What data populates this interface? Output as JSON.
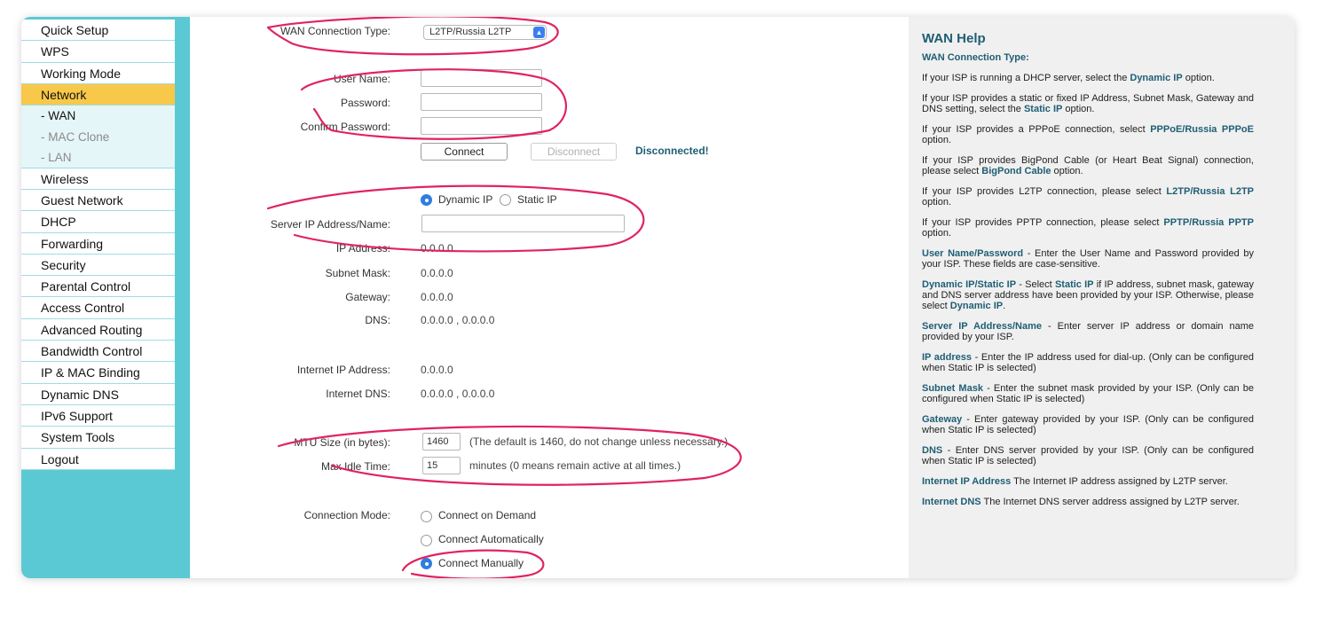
{
  "sidebar": {
    "items": [
      {
        "label": "Quick Setup"
      },
      {
        "label": "WPS"
      },
      {
        "label": "Working Mode"
      },
      {
        "label": "Network"
      },
      {
        "label": "- WAN"
      },
      {
        "label": "- MAC Clone"
      },
      {
        "label": "- LAN"
      },
      {
        "label": "Wireless"
      },
      {
        "label": "Guest Network"
      },
      {
        "label": "DHCP"
      },
      {
        "label": "Forwarding"
      },
      {
        "label": "Security"
      },
      {
        "label": "Parental Control"
      },
      {
        "label": "Access Control"
      },
      {
        "label": "Advanced Routing"
      },
      {
        "label": "Bandwidth Control"
      },
      {
        "label": "IP & MAC Binding"
      },
      {
        "label": "Dynamic DNS"
      },
      {
        "label": "IPv6 Support"
      },
      {
        "label": "System Tools"
      },
      {
        "label": "Logout"
      }
    ],
    "active": "Network",
    "current_sub": "- WAN"
  },
  "form": {
    "wan_type_label": "WAN Connection Type:",
    "wan_type_value": "L2TP/Russia L2TP",
    "username_label": "User Name:",
    "username_value": "",
    "password_label": "Password:",
    "password_value": "",
    "confirm_label": "Confirm Password:",
    "confirm_value": "",
    "connect_btn": "Connect",
    "disconnect_btn": "Disconnect",
    "status": "Disconnected!",
    "ip_mode": {
      "dynamic": "Dynamic IP",
      "static": "Static IP",
      "selected": "dynamic"
    },
    "server_label": "Server IP Address/Name:",
    "server_value": "",
    "ip_label": "IP Address:",
    "ip_value": "0.0.0.0",
    "mask_label": "Subnet Mask:",
    "mask_value": "0.0.0.0",
    "gateway_label": "Gateway:",
    "gateway_value": "0.0.0.0",
    "dns_label": "DNS:",
    "dns_value": "0.0.0.0 , 0.0.0.0",
    "inet_ip_label": "Internet IP Address:",
    "inet_ip_value": "0.0.0.0",
    "inet_dns_label": "Internet DNS:",
    "inet_dns_value": "0.0.0.0 , 0.0.0.0",
    "mtu_label": "MTU Size (in bytes):",
    "mtu_value": "1460",
    "mtu_note": "(The default is 1460, do not change unless necessary.)",
    "idle_label": "Max Idle Time:",
    "idle_value": "15",
    "idle_note": "minutes (0 means remain active at all times.)",
    "conn_mode_label": "Connection Mode:",
    "conn_mode_options": [
      "Connect on Demand",
      "Connect Automatically",
      "Connect Manually"
    ],
    "conn_mode_selected": "Connect Manually"
  },
  "help": {
    "title": "WAN Help",
    "subhead": "WAN Connection Type:",
    "p1_a": "If your ISP is running a DHCP server, select the ",
    "p1_b": "Dynamic IP",
    "p1_c": " option.",
    "p2_a": "If your ISP provides a static or fixed IP Address, Subnet Mask, Gateway and DNS setting, select the ",
    "p2_b": "Static IP",
    "p2_c": " option.",
    "p3_a": "If your ISP provides a PPPoE connection, select ",
    "p3_b": "PPPoE/Russia PPPoE",
    "p3_c": " option.",
    "p4_a": "If your ISP provides BigPond Cable (or Heart Beat Signal) connection, please select ",
    "p4_b": "BigPond Cable",
    "p4_c": " option.",
    "p5_a": "If your ISP provides L2TP connection, please select ",
    "p5_b": "L2TP/Russia L2TP",
    "p5_c": " option.",
    "p6_a": "If your ISP provides PPTP connection, please select ",
    "p6_b": "PPTP/Russia PPTP",
    "p6_c": " option.",
    "p7_b": "User Name/Password",
    "p7_c": " - Enter the User Name and Password provided by your ISP. These fields are case-sensitive.",
    "p8_b": "Dynamic IP/Static IP",
    "p8_c": " - Select ",
    "p8_d": "Static IP",
    "p8_e": " if IP address, subnet mask, gateway and DNS server address have been provided by your ISP. Otherwise, please select ",
    "p8_f": "Dynamic IP",
    "p8_g": ".",
    "p9_b": "Server IP Address/Name",
    "p9_c": " - Enter server IP address or domain name provided by your ISP.",
    "p10_b": "IP address",
    "p10_c": " - Enter the IP address used for dial-up. (Only can be configured when Static IP is selected)",
    "p11_b": "Subnet Mask",
    "p11_c": " - Enter the subnet mask provided by your ISP. (Only can be configured when Static IP is selected)",
    "p12_b": "Gateway",
    "p12_c": " - Enter gateway provided by your ISP. (Only can be configured when Static IP is selected)",
    "p13_b": "DNS",
    "p13_c": " - Enter DNS server provided by your ISP. (Only can be configured when Static IP is selected)",
    "p14_b": "Internet IP Address",
    "p14_c": " The Internet IP address assigned by L2TP server.",
    "p15_b": "Internet DNS",
    "p15_c": " The Internet DNS server address assigned by L2TP server."
  },
  "colors": {
    "sidebar_bg": "#5bc9d4",
    "active_item": "#f7c84a",
    "help_accent": "#1f5e74",
    "annotation": "#e0245e",
    "radio_on": "#2f7de1"
  }
}
